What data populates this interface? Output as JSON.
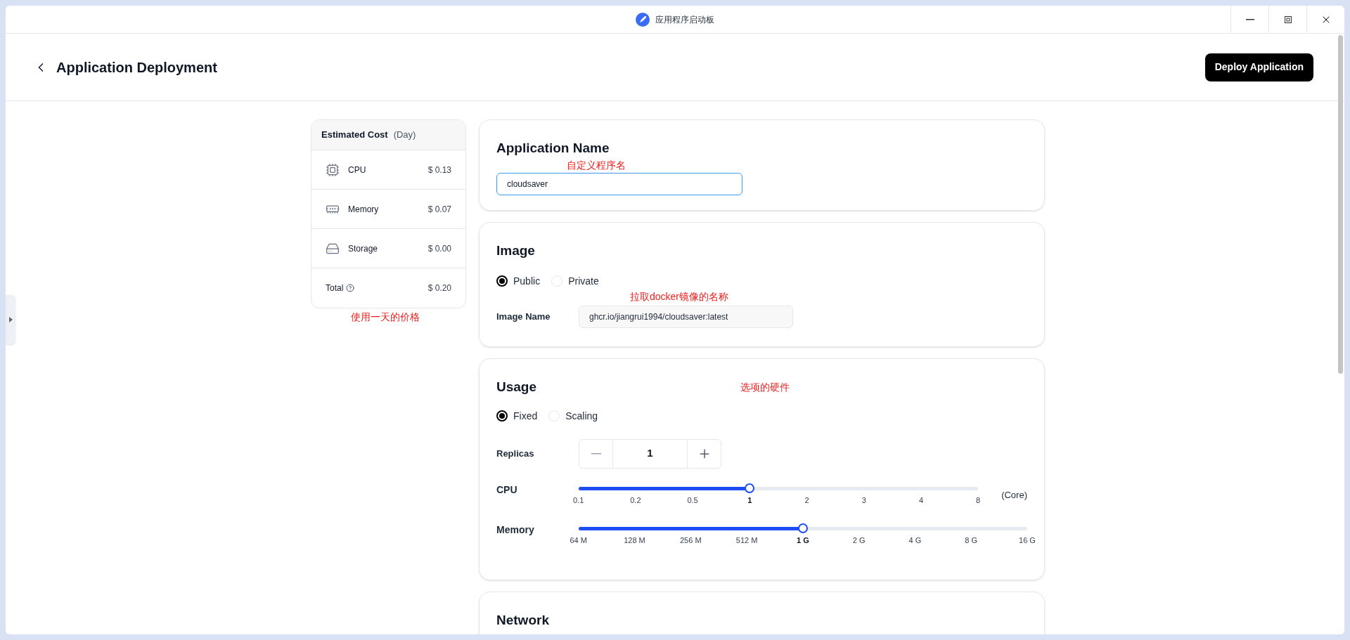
{
  "window": {
    "title": "应用程序启动板"
  },
  "header": {
    "title": "Application Deployment",
    "deploy_button": "Deploy Application"
  },
  "cost": {
    "title": "Estimated Cost",
    "period": "(Day)",
    "items": [
      {
        "kind": "cpu",
        "label": "CPU",
        "value": "$ 0.13"
      },
      {
        "kind": "memory",
        "label": "Memory",
        "value": "$ 0.07"
      },
      {
        "kind": "storage",
        "label": "Storage",
        "value": "$ 0.00"
      },
      {
        "kind": "total",
        "label": "Total",
        "value": "$ 0.20"
      }
    ],
    "annotation": "使用一天的价格"
  },
  "app_name": {
    "title": "Application Name",
    "annotation": "自定义程序名",
    "value": "cloudsaver"
  },
  "image": {
    "title": "Image",
    "options": [
      {
        "label": "Public",
        "selected": true
      },
      {
        "label": "Private",
        "selected": false
      }
    ],
    "annotation": "拉取docker镜像的名称",
    "field_label": "Image Name",
    "value": "ghcr.io/jiangrui1994/cloudsaver:latest"
  },
  "usage": {
    "title": "Usage",
    "annotation": "选项的硬件",
    "options": [
      {
        "label": "Fixed",
        "selected": true
      },
      {
        "label": "Scaling",
        "selected": false
      }
    ],
    "replicas": {
      "label": "Replicas",
      "value": "1"
    },
    "sliders": [
      {
        "label": "CPU",
        "level": 0.4286,
        "ticks": [
          "0.1",
          "0.2",
          "0.5",
          "1",
          "2",
          "3",
          "4",
          "8"
        ],
        "unit": "(Core)"
      },
      {
        "label": "Memory",
        "level": 0.5,
        "ticks": [
          "64 M",
          "128 M",
          "256 M",
          "512 M",
          "1 G",
          "2 G",
          "4 G",
          "8 G",
          "16 G"
        ]
      }
    ]
  },
  "network": {
    "title": "Network"
  }
}
